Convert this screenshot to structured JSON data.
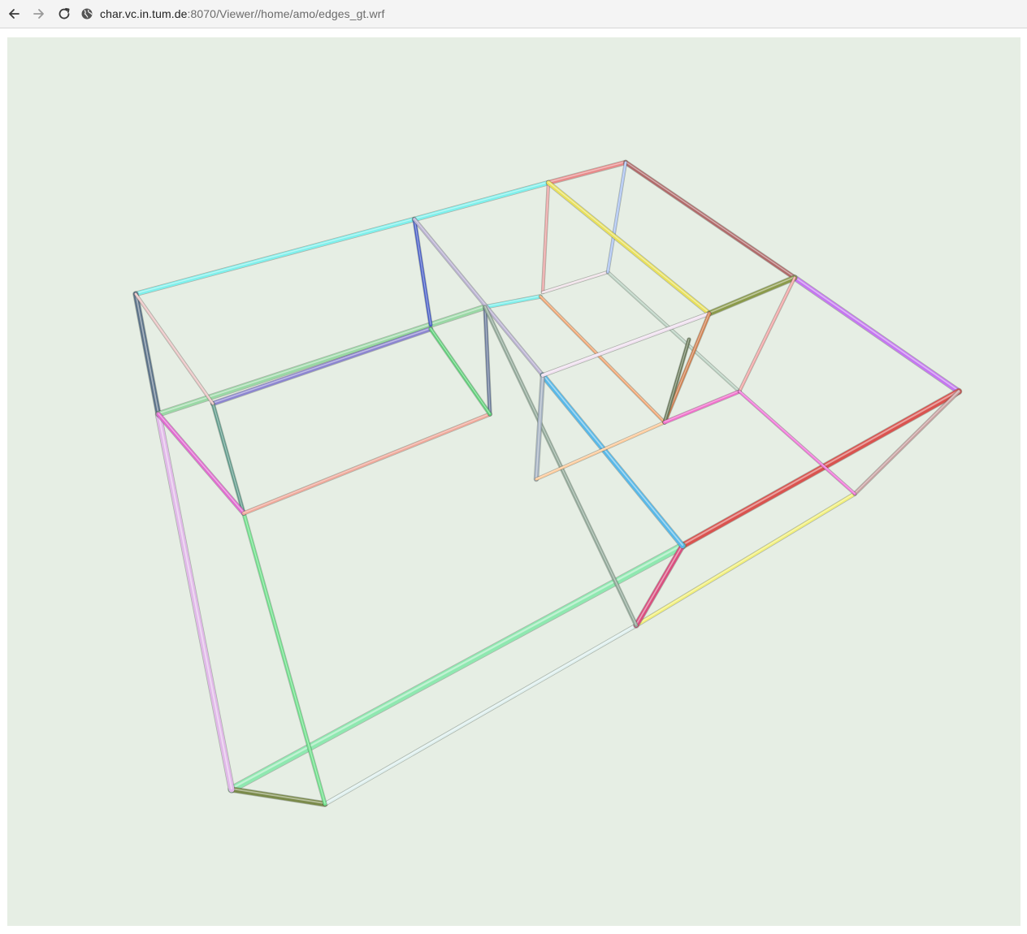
{
  "browser": {
    "url_host": "char.vc.in.tum.de",
    "url_path": ":8070/Viewer//home/amo/edges_gt.wrf",
    "back_icon": "arrow-left-icon",
    "forward_icon": "arrow-right-icon",
    "reload_icon": "reload-icon",
    "site_icon": "globe-icon"
  },
  "viewer": {
    "background": "#e6eee4",
    "edge_colors": [
      "#7ff0ec",
      "#e88a8a",
      "#b06a6a",
      "#c477f0",
      "#d9534f",
      "#f2f07a",
      "#8fe8b0",
      "#5d7389",
      "#c98be8",
      "#e0b8e8",
      "#9ad8a5",
      "#4a5fc7",
      "#a3b0c0",
      "#f0a16b",
      "#f06ecb",
      "#58b8e8",
      "#7a8a4a",
      "#f0a0a0",
      "#ffc896",
      "#dff0ef"
    ]
  }
}
